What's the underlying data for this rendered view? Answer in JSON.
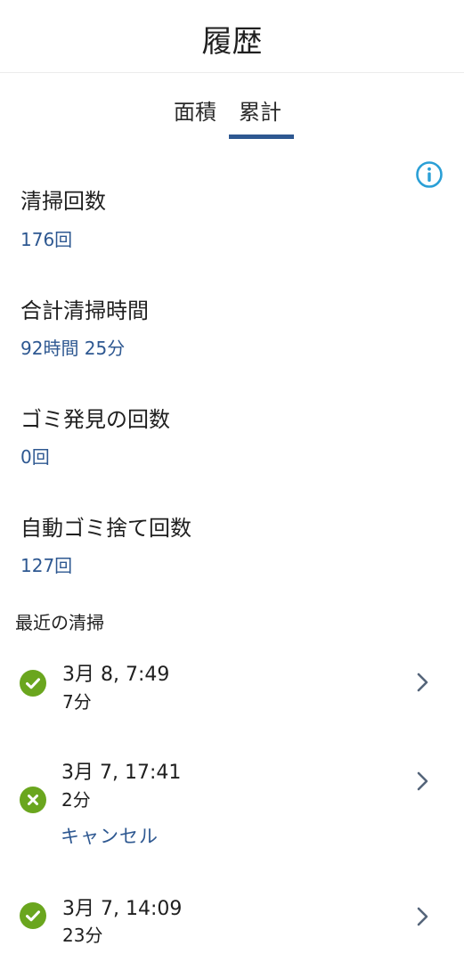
{
  "header": {
    "title": "履歴"
  },
  "tabs": [
    {
      "label": "面積",
      "active": false
    },
    {
      "label": "累計",
      "active": true
    }
  ],
  "stats": [
    {
      "label": "清掃回数",
      "value": "176回"
    },
    {
      "label": "合計清掃時間",
      "value": "92時間 25分"
    },
    {
      "label": "ゴミ発見の回数",
      "value": "0回"
    },
    {
      "label": "自動ゴミ捨て回数",
      "value": "127回"
    }
  ],
  "recent": {
    "title": "最近の清掃",
    "items": [
      {
        "date": "3月 8, 7:49",
        "duration": "7分",
        "status": "completed",
        "note": ""
      },
      {
        "date": "3月 7, 17:41",
        "duration": "2分",
        "status": "cancelled",
        "note": "キャンセル"
      },
      {
        "date": "3月 7, 14:09",
        "duration": "23分",
        "status": "completed",
        "note": ""
      }
    ]
  },
  "icons": {
    "info": "info-icon",
    "success": "check-circle-icon",
    "cancel": "x-circle-icon",
    "chevron": "chevron-right-icon"
  },
  "colors": {
    "accent": "#2e5891",
    "info": "#2a9fd6",
    "success": "#6aa61e",
    "text": "#1f1f1f"
  }
}
